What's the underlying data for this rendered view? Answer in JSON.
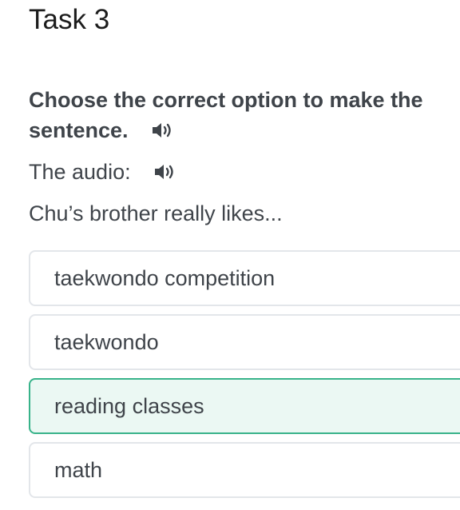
{
  "task": {
    "title": "Task 3"
  },
  "instruction": {
    "line1": "Choose the correct option to make the",
    "line2": "sentence.",
    "speaker_icon": "speaker-icon"
  },
  "audio": {
    "label": "The audio:",
    "speaker_icon": "speaker-icon"
  },
  "question": {
    "prompt": "Chu’s brother really likes..."
  },
  "options": [
    {
      "label": "taekwondo competition",
      "selected": false
    },
    {
      "label": "taekwondo",
      "selected": false
    },
    {
      "label": "reading classes",
      "selected": true
    },
    {
      "label": "math",
      "selected": false
    }
  ],
  "colors": {
    "selected_border": "#38b38a",
    "selected_background": "#ebf8f3",
    "option_border": "#e3e6ea",
    "text": "#3f444a"
  }
}
